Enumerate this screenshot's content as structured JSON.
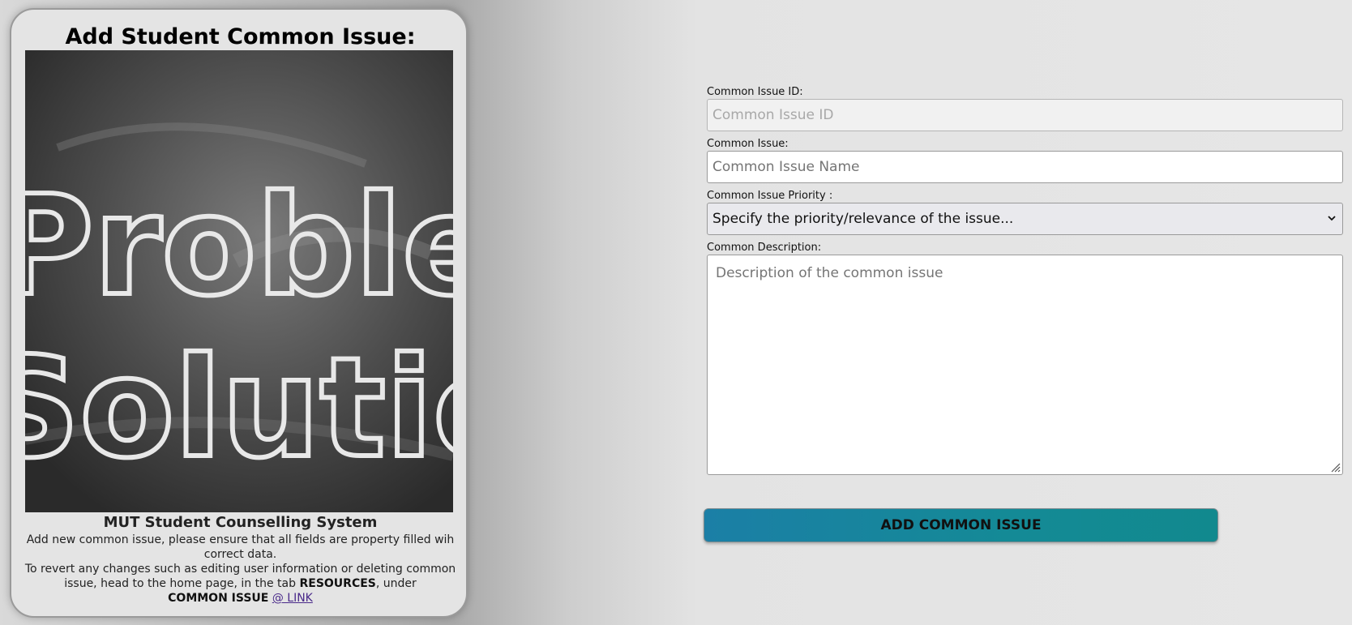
{
  "card": {
    "title": "Add Student Common Issue:",
    "image_words": [
      "Problem",
      "Solution"
    ],
    "system_title": "MUT Student Counselling System",
    "info_line1": "Add new common issue, please ensure that all fields are property filled wih correct data.",
    "info_line2_pre": "To revert any changes such as editing user information or deleting common issue, head to the home page, in the tab ",
    "info_line2_bold1": "RESOURCES",
    "info_line2_mid": ", under",
    "info_line2_bold2": "COMMON ISSUE",
    "info_link": "@ LINK"
  },
  "form": {
    "id_label": "Common Issue ID:",
    "id_placeholder": "Common Issue ID",
    "name_label": "Common Issue:",
    "name_placeholder": "Common Issue Name",
    "priority_label": "Common Issue Priority :",
    "priority_selected": "Specify the priority/relevance of the issue...",
    "description_label": "Common Description:",
    "description_placeholder": "Description of the common issue",
    "submit_label": "ADD COMMON ISSUE"
  },
  "icons": {
    "select": "chevron-down-icon",
    "textarea": "resize-grip-icon"
  }
}
